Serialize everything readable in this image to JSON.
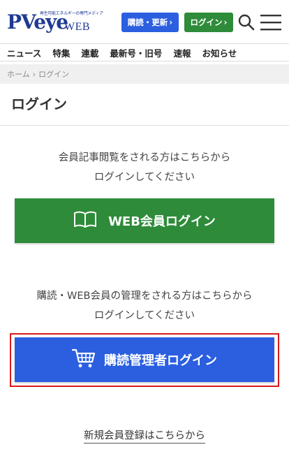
{
  "header": {
    "logo_tagline": "再生可能エネルギーの専門メディア",
    "logo_main": "PVeye",
    "logo_sub": "WEB",
    "subscribe_label": "購読・更新",
    "login_label": "ログイン",
    "chevron": "›",
    "search_icon": "search-icon",
    "menu_icon": "hamburger-menu-icon",
    "brand_color": "#1f3a93"
  },
  "nav": {
    "items": [
      {
        "label": "ニュース"
      },
      {
        "label": "特集"
      },
      {
        "label": "連載"
      },
      {
        "label": "最新号・旧号"
      },
      {
        "label": "速報"
      },
      {
        "label": "お知らせ"
      }
    ]
  },
  "breadcrumb": {
    "home": "ホーム",
    "separator": "›",
    "current": "ログイン"
  },
  "page": {
    "title": "ログイン",
    "member_msg_line1": "会員記事閲覧をされる方はこちらから",
    "member_msg_line2": "ログインしてください",
    "web_login_label": "WEB会員ログイン",
    "web_login_icon": "book-icon",
    "web_login_color": "#2e8b3a",
    "sub_msg_line1": "購読・WEB会員の管理をされる方はこちらから",
    "sub_msg_line2": "ログインしてください",
    "sub_login_label": "購読管理者ログイン",
    "sub_login_icon": "cart-icon",
    "sub_login_color": "#2b5fe0",
    "highlight_color": "#d71a1a",
    "register_link": "新規会員登録はこちらから"
  }
}
